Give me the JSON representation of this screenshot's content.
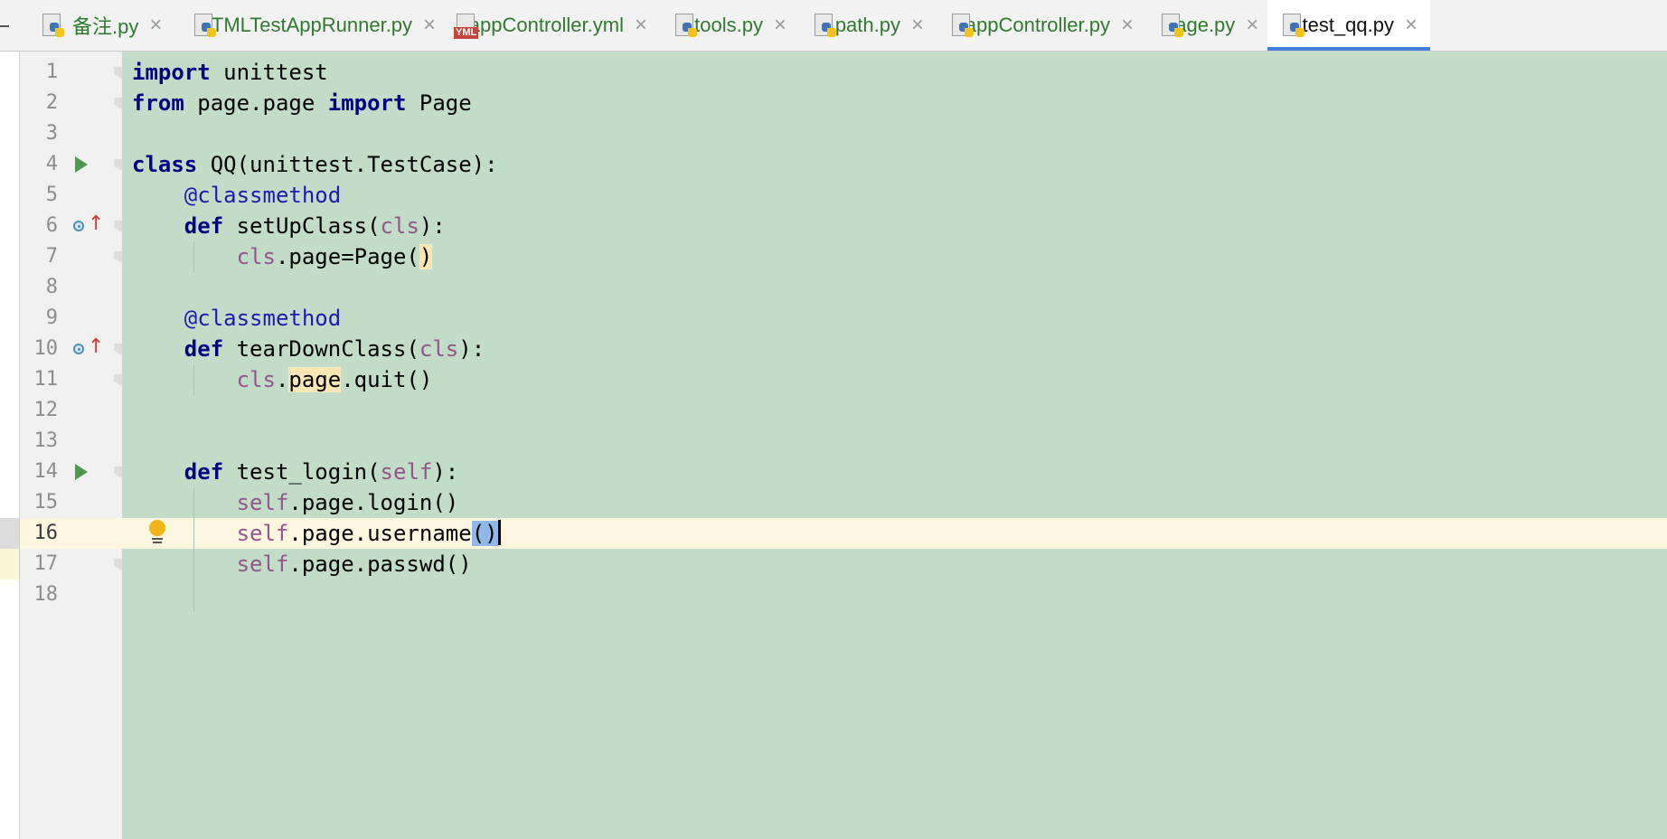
{
  "tabbar": {
    "tabs": [
      {
        "label": "备注.py",
        "icon": "python-file-icon",
        "active": false
      },
      {
        "label": "HTMLTestAppRunner.py",
        "icon": "python-file-icon",
        "active": false
      },
      {
        "label": "appController.yml",
        "icon": "yaml-file-icon",
        "icon_text": "YML",
        "active": false
      },
      {
        "label": "tools.py",
        "icon": "python-file-icon",
        "active": false
      },
      {
        "label": "path.py",
        "icon": "python-file-icon",
        "active": false
      },
      {
        "label": "appController.py",
        "icon": "python-file-icon",
        "active": false
      },
      {
        "label": "page.py",
        "icon": "python-file-icon",
        "active": false
      },
      {
        "label": "test_qq.py",
        "icon": "python-file-icon",
        "active": true
      }
    ],
    "close_glyph": "×"
  },
  "editor": {
    "current_line": 16,
    "colors": {
      "background": "#c1ddc7",
      "current_line": "#fcf6df",
      "keyword": "#000080",
      "decorator": "#1b1bb3",
      "self_param": "#94558d",
      "active_tab_underline": "#3d7fd9"
    },
    "lines": [
      {
        "number": "1",
        "tokens": [
          {
            "t": "import",
            "k": "kw"
          },
          {
            "t": " unittest"
          }
        ]
      },
      {
        "number": "2",
        "tokens": [
          {
            "t": "from",
            "k": "kw"
          },
          {
            "t": " page.page "
          },
          {
            "t": "import",
            "k": "kw"
          },
          {
            "t": " Page"
          }
        ]
      },
      {
        "number": "3",
        "tokens": []
      },
      {
        "number": "4",
        "gutter_icon": "run-icon",
        "tokens": [
          {
            "t": "class",
            "k": "kw"
          },
          {
            "t": " QQ(unittest.TestCase):"
          }
        ]
      },
      {
        "number": "5",
        "tokens": [
          {
            "t": "    "
          },
          {
            "t": "@classmethod",
            "k": "deco"
          }
        ]
      },
      {
        "number": "6",
        "gutter_icon": "override-icon",
        "tokens": [
          {
            "t": "    "
          },
          {
            "t": "def",
            "k": "kw"
          },
          {
            "t": " setUpClass("
          },
          {
            "t": "cls",
            "k": "self"
          },
          {
            "t": "):"
          }
        ]
      },
      {
        "number": "7",
        "tokens": [
          {
            "t": "        "
          },
          {
            "t": "cls",
            "k": "self"
          },
          {
            "t": ".page=Page("
          },
          {
            "t": ")",
            "k": "hl-warm"
          }
        ]
      },
      {
        "number": "8",
        "tokens": []
      },
      {
        "number": "9",
        "tokens": [
          {
            "t": "    "
          },
          {
            "t": "@classmethod",
            "k": "deco"
          }
        ]
      },
      {
        "number": "10",
        "gutter_icon": "override-icon",
        "tokens": [
          {
            "t": "    "
          },
          {
            "t": "def",
            "k": "kw"
          },
          {
            "t": " tearDownClass("
          },
          {
            "t": "cls",
            "k": "self"
          },
          {
            "t": "):"
          }
        ]
      },
      {
        "number": "11",
        "tokens": [
          {
            "t": "        "
          },
          {
            "t": "cls",
            "k": "self"
          },
          {
            "t": "."
          },
          {
            "t": "page",
            "k": "hl-warm"
          },
          {
            "t": ".quit()"
          }
        ]
      },
      {
        "number": "12",
        "tokens": []
      },
      {
        "number": "13",
        "tokens": []
      },
      {
        "number": "14",
        "gutter_icon": "run-icon",
        "tokens": [
          {
            "t": "    "
          },
          {
            "t": "def",
            "k": "kw"
          },
          {
            "t": " test_login("
          },
          {
            "t": "self",
            "k": "self"
          },
          {
            "t": "):"
          }
        ]
      },
      {
        "number": "15",
        "tokens": [
          {
            "t": "        "
          },
          {
            "t": "self",
            "k": "self"
          },
          {
            "t": ".page.login()"
          }
        ]
      },
      {
        "number": "16",
        "gutter_icon": "lightbulb-icon",
        "tokens": [
          {
            "t": "        "
          },
          {
            "t": "self",
            "k": "self"
          },
          {
            "t": ".page.username"
          },
          {
            "t": "()",
            "k": "hl-sel"
          },
          {
            "t": "",
            "k": "caret"
          }
        ]
      },
      {
        "number": "17",
        "tokens": [
          {
            "t": "        "
          },
          {
            "t": "self",
            "k": "self"
          },
          {
            "t": ".page.passwd()"
          }
        ]
      },
      {
        "number": "18",
        "tokens": []
      }
    ]
  }
}
